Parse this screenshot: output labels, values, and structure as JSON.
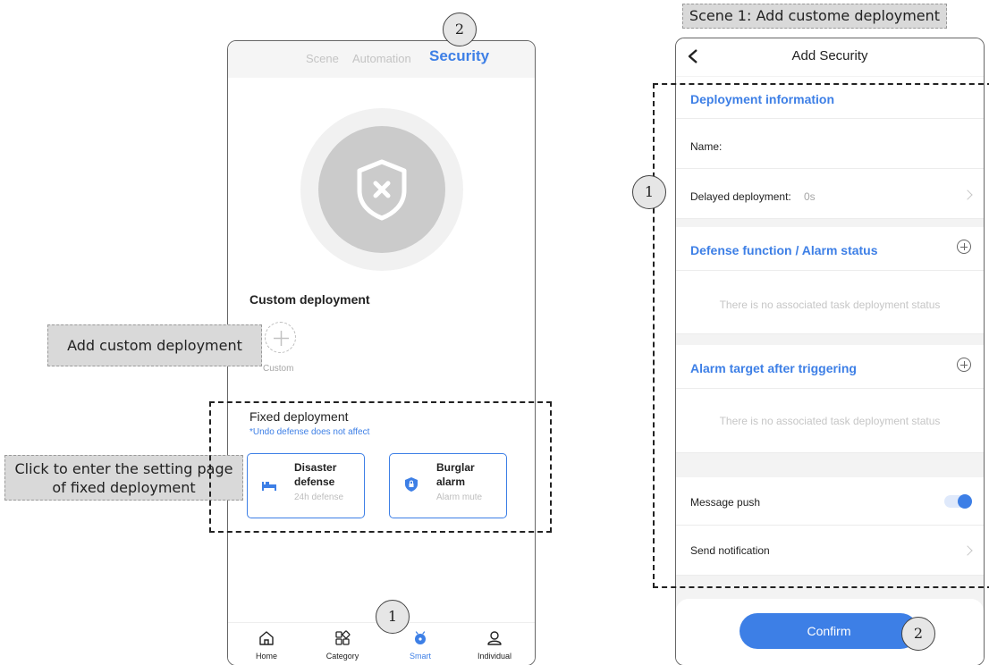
{
  "left_phone": {
    "tabs": [
      {
        "label": "Scene"
      },
      {
        "label": "Automation"
      },
      {
        "label": "Security",
        "active": true
      }
    ],
    "status_icon": "shield-x-icon",
    "custom_section": {
      "title": "Custom deployment",
      "item_label": "Custom"
    },
    "fixed_section": {
      "title": "Fixed deployment",
      "note": "*Undo defense does not affect",
      "cards": [
        {
          "title_line1": "Disaster",
          "title_line2": "defense",
          "subtitle": "24h defense",
          "icon": "bed-icon"
        },
        {
          "title_line1": "Burglar",
          "title_line2": "alarm",
          "subtitle": "Alarm mute",
          "icon": "shield-lock-icon"
        }
      ]
    },
    "tabbar": [
      {
        "label": "Home",
        "icon": "home-icon"
      },
      {
        "label": "Category",
        "icon": "category-icon"
      },
      {
        "label": "Smart",
        "icon": "smart-icon",
        "active": true
      },
      {
        "label": "Individual",
        "icon": "person-icon"
      }
    ]
  },
  "right_phone": {
    "nav_title": "Add Security",
    "deployment_info": {
      "header": "Deployment information",
      "name_label": "Name:",
      "delay_label": "Delayed deployment:",
      "delay_value": "0s"
    },
    "defense_function": {
      "header": "Defense function / Alarm status",
      "empty": "There is no associated task deployment status"
    },
    "alarm_target": {
      "header": "Alarm target after triggering",
      "empty": "There is no associated task deployment status"
    },
    "message_push": {
      "label": "Message push",
      "enabled": true
    },
    "send_notification": {
      "label": "Send notification"
    },
    "confirm_label": "Confirm"
  },
  "annotations": {
    "scene_title": "Scene 1: Add custome deployment",
    "add_custom": "Add custom deployment",
    "click_fixed_line1": "Click to enter the setting page",
    "click_fixed_line2": "of fixed deployment",
    "left_step_smart": "1",
    "left_step_security": "2",
    "right_step_info": "1",
    "right_step_confirm": "2"
  },
  "colors": {
    "accent": "#3d7fe6",
    "muted": "#c4c4c4"
  }
}
